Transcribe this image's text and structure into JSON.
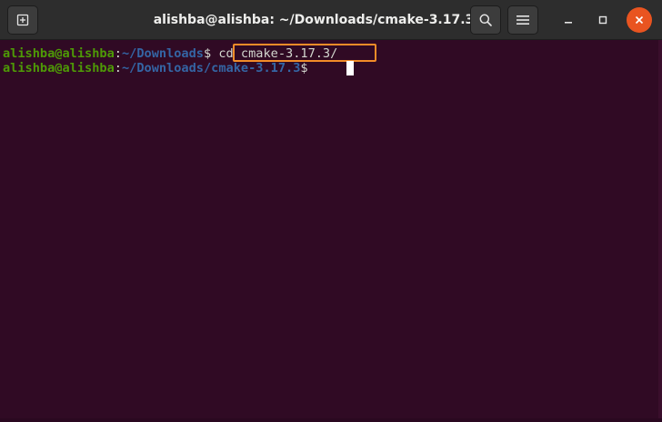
{
  "window": {
    "title": "alishba@alishba: ~/Downloads/cmake-3.17.3"
  },
  "titlebar": {
    "new_tab_icon": "new-tab-icon",
    "search_icon": "search-icon",
    "menu_icon": "hamburger-menu-icon",
    "minimize_icon": "minimize-icon",
    "maximize_icon": "maximize-icon",
    "close_icon": "close-icon"
  },
  "terminal": {
    "lines": [
      {
        "user": "alishba@alishba",
        "sep": ":",
        "path": "~/Downloads",
        "dollar": "$",
        "command": " cd cmake-3.17.3/"
      },
      {
        "user": "alishba@alishba",
        "sep": ":",
        "path": "~/Downloads/cmake-3.17.3",
        "dollar": "$",
        "command": " "
      }
    ]
  },
  "colors": {
    "background": "#300a24",
    "titlebar": "#2d2d2d",
    "prompt_user": "#4e9a06",
    "prompt_path": "#3465a4",
    "highlight": "#f28c28",
    "close_button": "#e95420"
  }
}
